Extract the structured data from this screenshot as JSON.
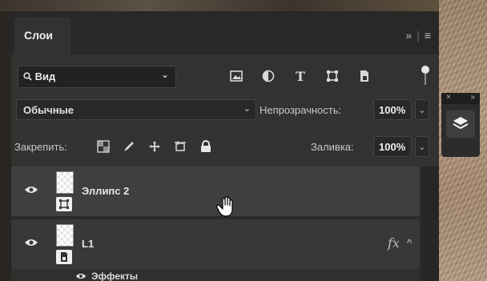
{
  "panel": {
    "tab_title": "Слои",
    "collapse_glyph": "»",
    "menu_glyph": "≡"
  },
  "filter": {
    "kind_label": "Вид",
    "icons": [
      "image-filter-icon",
      "adjustment-filter-icon",
      "type-filter-icon",
      "shape-filter-icon",
      "smart-object-filter-icon"
    ]
  },
  "blend": {
    "mode": "Обычные",
    "opacity_label": "Непрозрачность:",
    "opacity_value": "100%"
  },
  "lock": {
    "label": "Закрепить:",
    "icons": [
      "lock-transparent-pixels-icon",
      "lock-image-pixels-icon",
      "lock-position-icon",
      "prevent-autonest-icon",
      "lock-all-icon"
    ],
    "fill_label": "Заливка:",
    "fill_value": "100%"
  },
  "layers": [
    {
      "name": "Эллипс 2",
      "visible": true,
      "selected": true,
      "type": "shape",
      "has_fx": false
    },
    {
      "name": "L1",
      "visible": true,
      "selected": false,
      "type": "smart-object",
      "has_fx": true,
      "fx_label": "fx"
    }
  ],
  "effects": {
    "label": "Эффекты"
  },
  "side_dock": {
    "close_glyph": "×",
    "expand_glyph": "»"
  }
}
